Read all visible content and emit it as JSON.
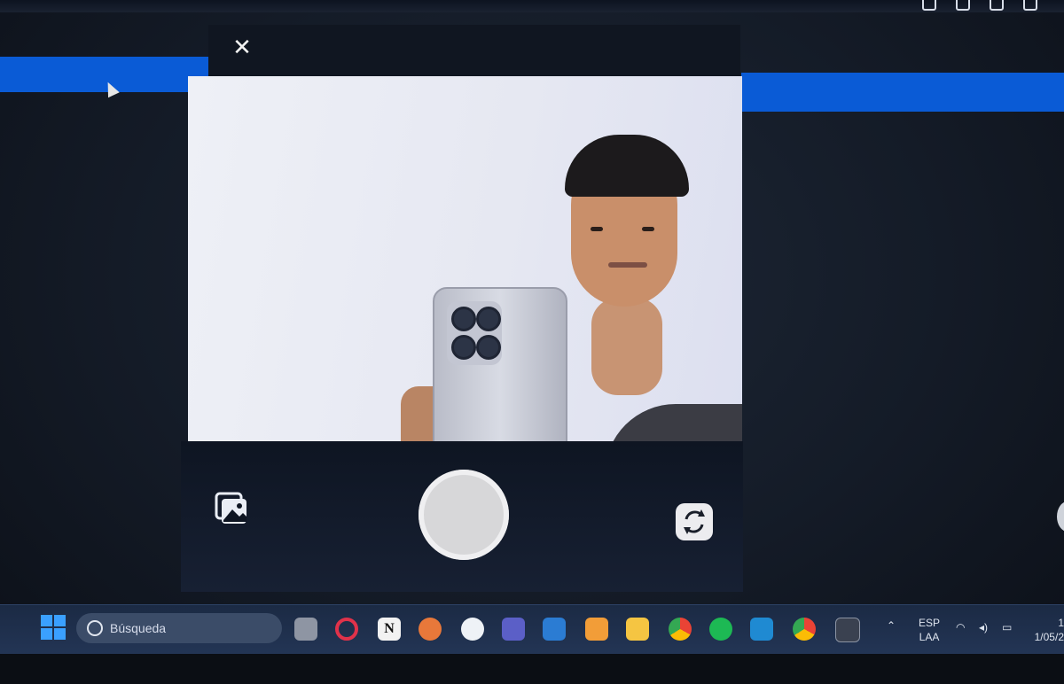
{
  "camera": {
    "close_icon": "close-icon",
    "gallery_icon": "gallery-icon",
    "shutter_icon": "shutter-button",
    "switch_icon": "switch-camera-icon"
  },
  "taskbar": {
    "search_placeholder": "Búsqueda",
    "apps": [
      "task-view-icon",
      "opera-icon",
      "notion-icon",
      "swift-icon",
      "maps-icon",
      "teams-icon",
      "word-icon",
      "sublime-icon",
      "file-explorer-icon",
      "chrome-icon",
      "spotify-icon",
      "vscode-icon",
      "chrome-profile-icon",
      "terminal-icon"
    ],
    "tray": {
      "lang_top": "ESP",
      "lang_bottom": "LAA",
      "time": "1",
      "date": "1/05/2"
    }
  },
  "colors": {
    "accent_blue": "#0a5bd6",
    "taskbar": "#233555",
    "shutter": "#d7d7d9"
  }
}
